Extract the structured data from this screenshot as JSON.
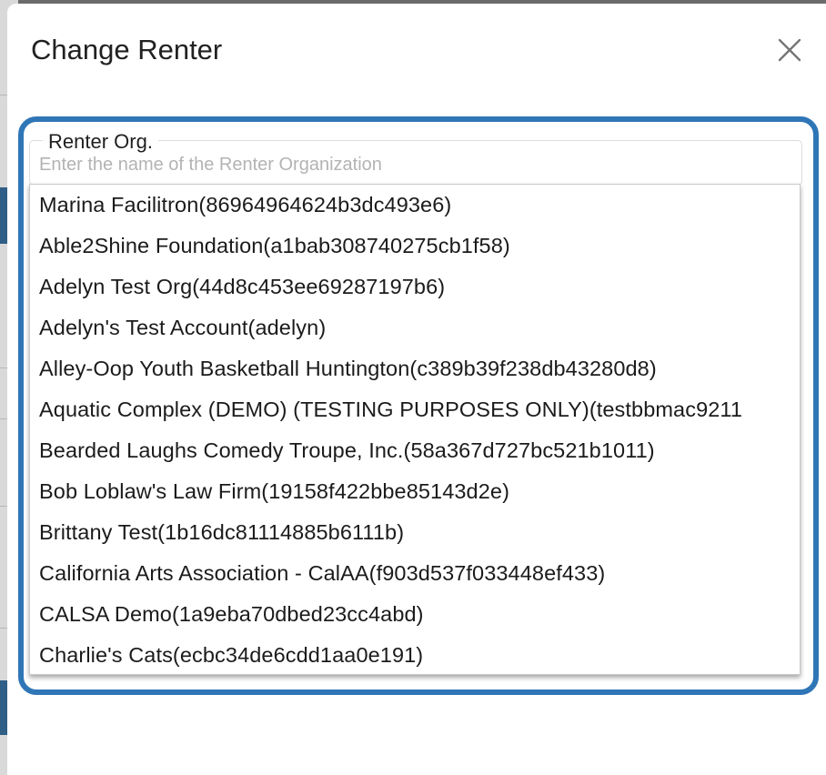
{
  "dialog": {
    "title": "Change Renter",
    "close_icon": "close-icon"
  },
  "renter_field": {
    "legend": "Renter Org.",
    "placeholder": "Enter the name of the Renter Organization",
    "value": ""
  },
  "options": [
    "Marina Facilitron(86964964624b3dc493e6)",
    "Able2Shine Foundation(a1bab308740275cb1f58)",
    "Adelyn Test Org(44d8c453ee69287197b6)",
    "Adelyn's Test Account(adelyn)",
    "Alley-Oop Youth Basketball Huntington(c389b39f238db43280d8)",
    "Aquatic Complex (DEMO) (TESTING PURPOSES ONLY)(testbbmac9211",
    "Bearded Laughs Comedy Troupe, Inc.(58a367d727bc521b1011)",
    "Bob Loblaw's Law Firm(19158f422bbe85143d2e)",
    "Brittany Test(1b16dc81114885b6111b)",
    "California Arts Association - CalAA(f903d537f033448ef433)",
    "CALSA Demo(1a9eba70dbed23cc4abd)",
    "Charlie's Cats(ecbc34de6cdd1aa0e191)"
  ],
  "colors": {
    "focus_ring": "#2f76b6",
    "overlay": "#6b6b6b"
  }
}
